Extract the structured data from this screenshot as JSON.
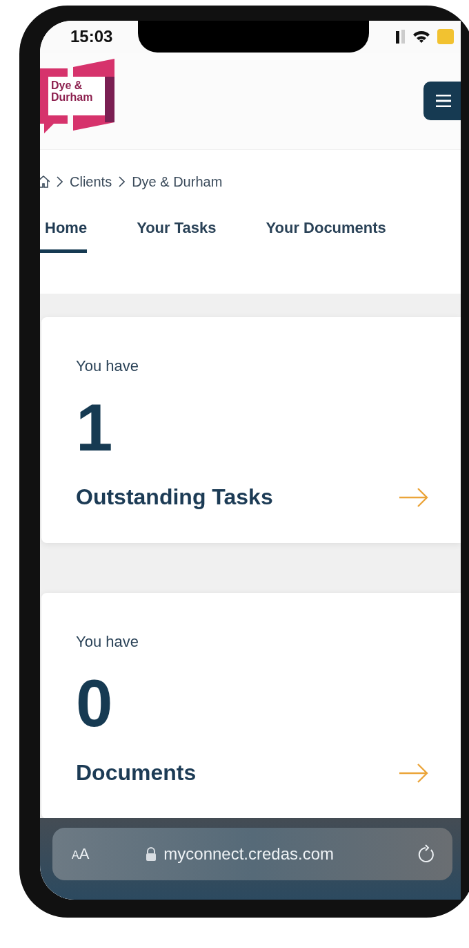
{
  "status_bar": {
    "time": "15:03"
  },
  "header": {
    "logo_lines": [
      "Dye &",
      "Durham"
    ]
  },
  "breadcrumb": [
    "Clients",
    "Dye & Durham"
  ],
  "tabs": [
    {
      "label": "Home",
      "selected": true
    },
    {
      "label": "Your Tasks",
      "selected": false
    },
    {
      "label": "Your Documents",
      "selected": false
    }
  ],
  "cards": [
    {
      "intro": "You have",
      "count": "1",
      "label": "Outstanding Tasks"
    },
    {
      "intro": "You have",
      "count": "0",
      "label": "Documents"
    }
  ],
  "browser_bar": {
    "text_size_button": "AA",
    "url": "myconnect.credas.com"
  }
}
